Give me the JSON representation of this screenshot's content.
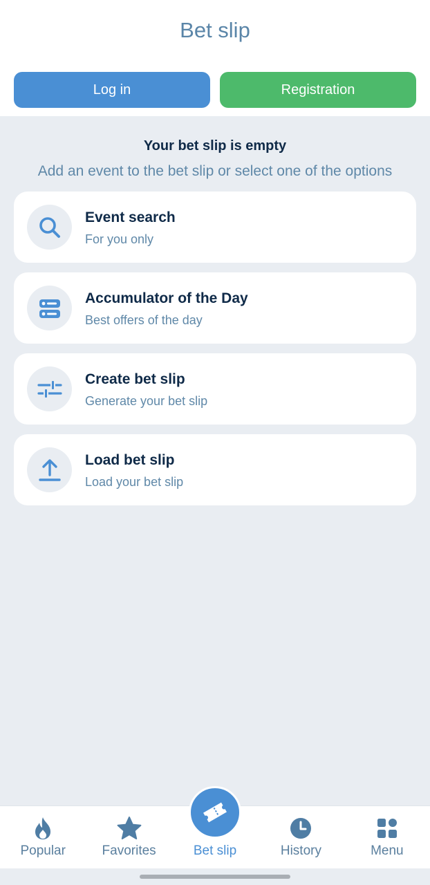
{
  "header": {
    "title": "Bet slip",
    "login_label": "Log in",
    "register_label": "Registration"
  },
  "empty_state": {
    "title": "Your bet slip is empty",
    "subtitle": "Add an event to the bet slip or select one of the options"
  },
  "options": [
    {
      "title": "Event search",
      "subtitle": "For you only",
      "icon": "search-icon"
    },
    {
      "title": "Accumulator of the Day",
      "subtitle": "Best offers of the day",
      "icon": "accumulator-icon"
    },
    {
      "title": "Create bet slip",
      "subtitle": "Generate your bet slip",
      "icon": "sliders-icon"
    },
    {
      "title": "Load bet slip",
      "subtitle": "Load your bet slip",
      "icon": "upload-icon"
    }
  ],
  "nav": {
    "items": [
      {
        "label": "Popular",
        "icon": "flame-icon"
      },
      {
        "label": "Favorites",
        "icon": "star-icon"
      },
      {
        "label": "Bet slip",
        "icon": "ticket-icon",
        "active": true
      },
      {
        "label": "History",
        "icon": "clock-icon"
      },
      {
        "label": "Menu",
        "icon": "grid-icon"
      }
    ]
  },
  "colors": {
    "accent": "#4a8fd4",
    "success": "#4dba6b",
    "text_dark": "#0f2a48",
    "text_muted": "#5f88a8",
    "background": "#e9edf2"
  }
}
